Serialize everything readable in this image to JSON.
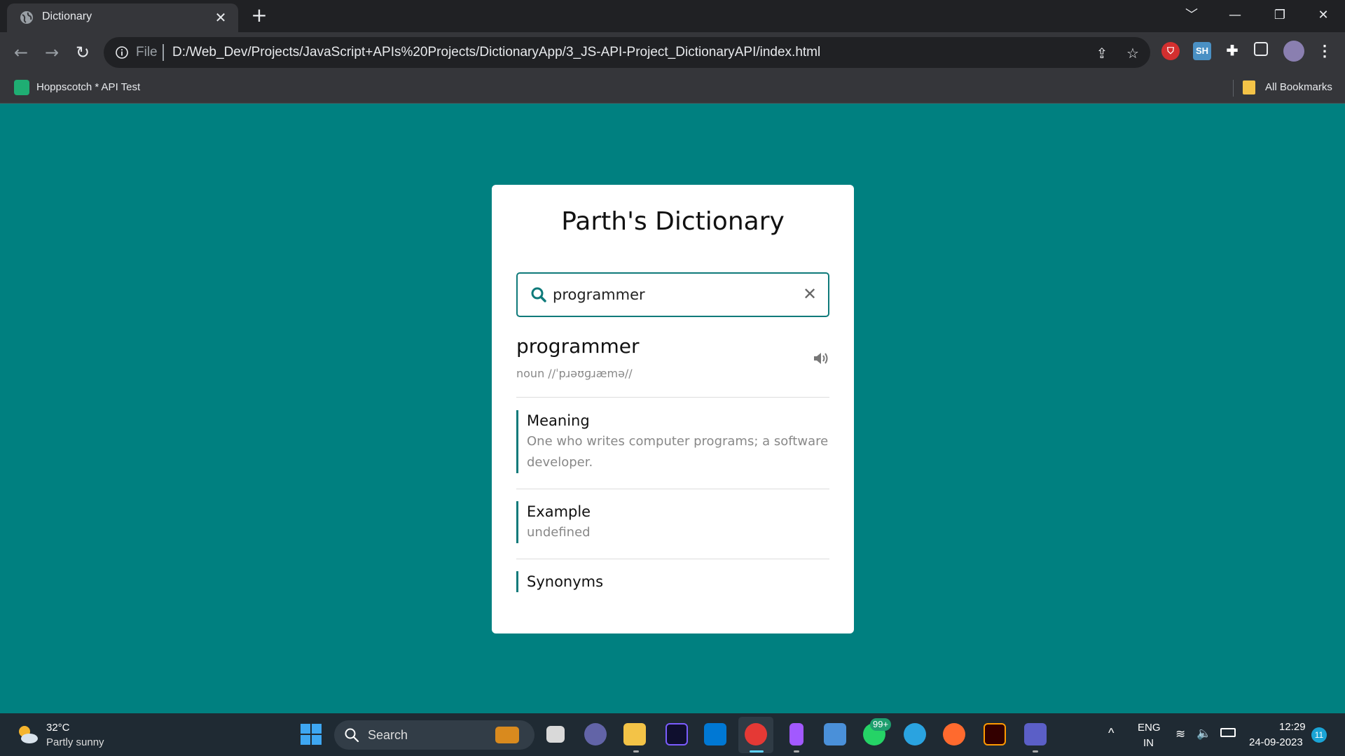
{
  "browser": {
    "tab_title": "Dictionary",
    "address_scheme": "File",
    "address_url": "D:/Web_Dev/Projects/JavaScript+APIs%20Projects/DictionaryApp/3_JS-API-Project_DictionaryAPI/index.html",
    "bookmark_label": "Hoppscotch * API Test",
    "all_bookmarks_label": "All Bookmarks",
    "extension_sh_label": "SH"
  },
  "page": {
    "title": "Parth's Dictionary",
    "search_value": "programmer",
    "word": "programmer",
    "phonetic": "noun //ˈpɹəʊɡɹæmə//",
    "sections": [
      {
        "heading": "Meaning",
        "text": "One who writes computer programs; a software developer."
      },
      {
        "heading": "Example",
        "text": "undefined"
      },
      {
        "heading": "Synonyms",
        "text": ""
      }
    ]
  },
  "taskbar": {
    "weather_temp": "32°C",
    "weather_condition": "Partly sunny",
    "search_label": "Search",
    "whatsapp_badge": "99+",
    "language": "ENG",
    "region": "IN",
    "time": "12:29",
    "date": "24-09-2023",
    "notification_count": "11"
  },
  "colors": {
    "page_background": "#008080",
    "accent": "#0f7a7a",
    "card_background": "#ffffff"
  },
  "icons": {
    "search": "search-icon",
    "clear": "close-icon",
    "pronounce": "speaker-icon"
  }
}
